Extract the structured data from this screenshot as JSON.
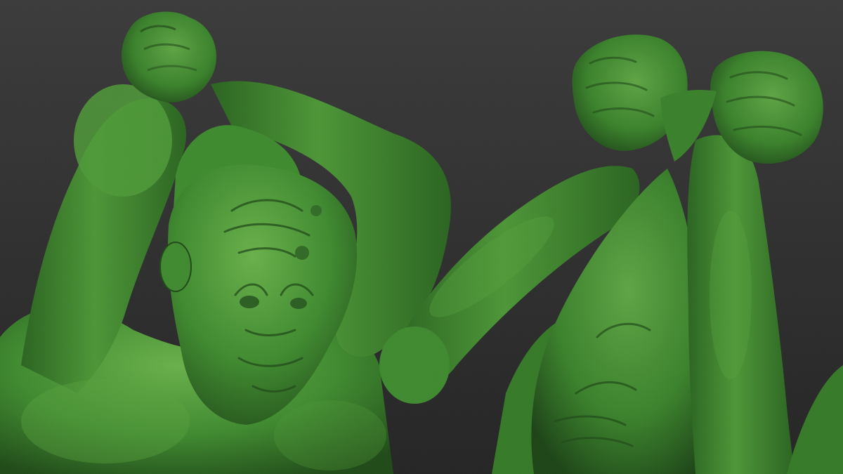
{
  "scene": {
    "description_hidden": "",
    "colors": {
      "background_top": "#3a3a3a",
      "background_bottom": "#242424",
      "clay_base": "#3f8a2f",
      "clay_light": "#67ad48",
      "clay_dark": "#1f4a17"
    },
    "subjects": [
      "left-figure",
      "right-figure"
    ]
  }
}
